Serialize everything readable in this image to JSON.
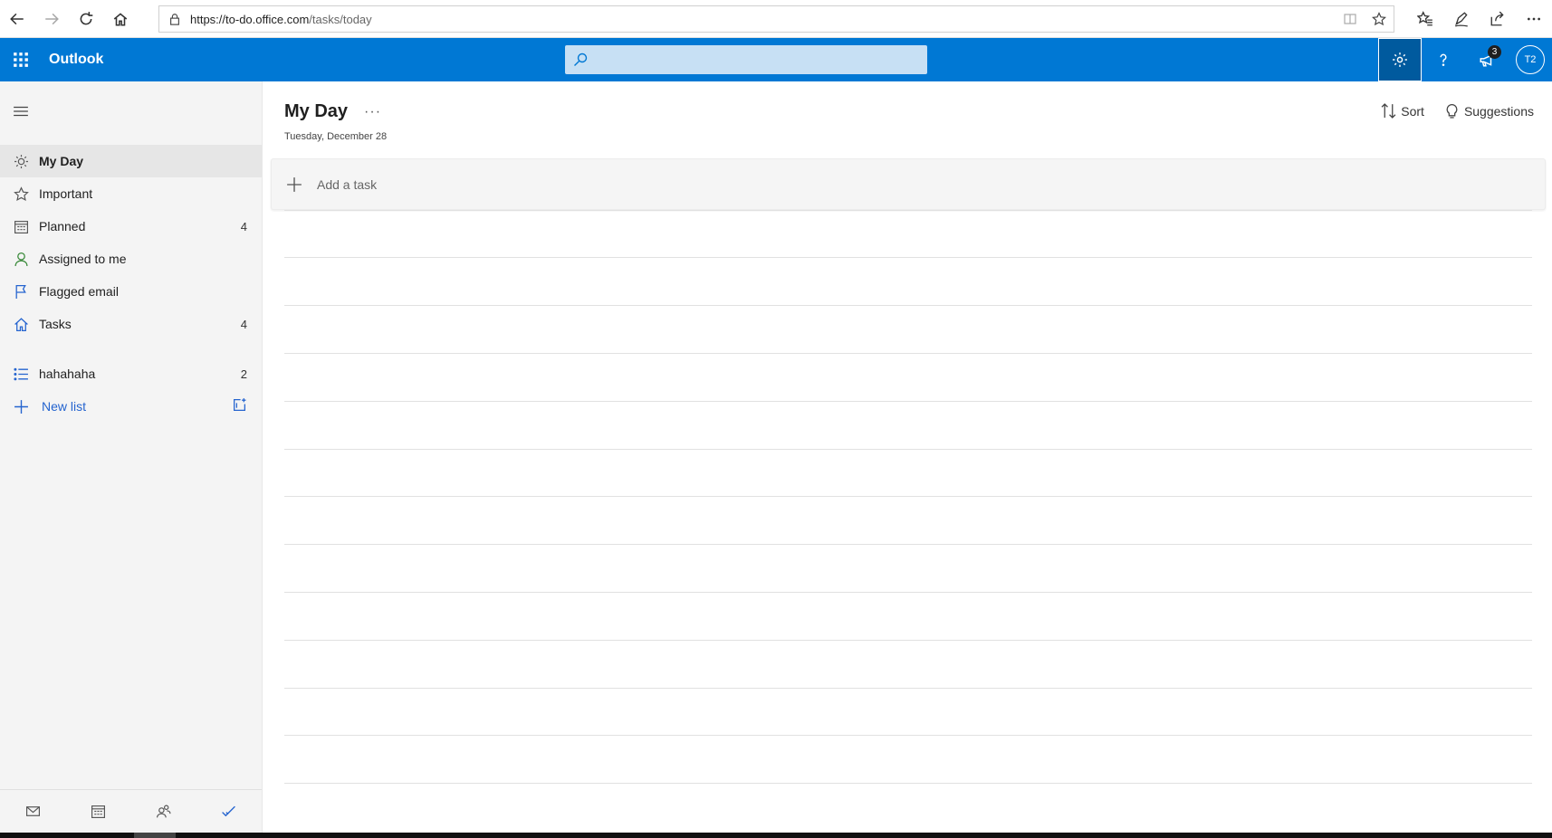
{
  "browser": {
    "url_host": "https://to-do.office.com",
    "url_path": "/tasks/today"
  },
  "header": {
    "app_name": "Outlook",
    "search_placeholder": "",
    "notifications_count": "3",
    "avatar_initials": "T2"
  },
  "sidebar": {
    "items": [
      {
        "label": "My Day",
        "count": "",
        "icon": "sun-icon",
        "selected": true
      },
      {
        "label": "Important",
        "count": "",
        "icon": "star-icon"
      },
      {
        "label": "Planned",
        "count": "4",
        "icon": "calendar-icon"
      },
      {
        "label": "Assigned to me",
        "count": "",
        "icon": "person-icon"
      },
      {
        "label": "Flagged email",
        "count": "",
        "icon": "flag-icon"
      },
      {
        "label": "Tasks",
        "count": "4",
        "icon": "home-icon"
      }
    ],
    "lists": [
      {
        "label": "hahahaha",
        "count": "2",
        "icon": "list-icon"
      }
    ],
    "new_list_label": "New list"
  },
  "main": {
    "title": "My Day",
    "date": "Tuesday, December 28",
    "sort_label": "Sort",
    "suggestions_label": "Suggestions",
    "add_task_placeholder": "Add a task"
  },
  "colors": {
    "brand": "#0078d4",
    "accent": "#2564cf",
    "search_bg": "#c7e0f4"
  }
}
